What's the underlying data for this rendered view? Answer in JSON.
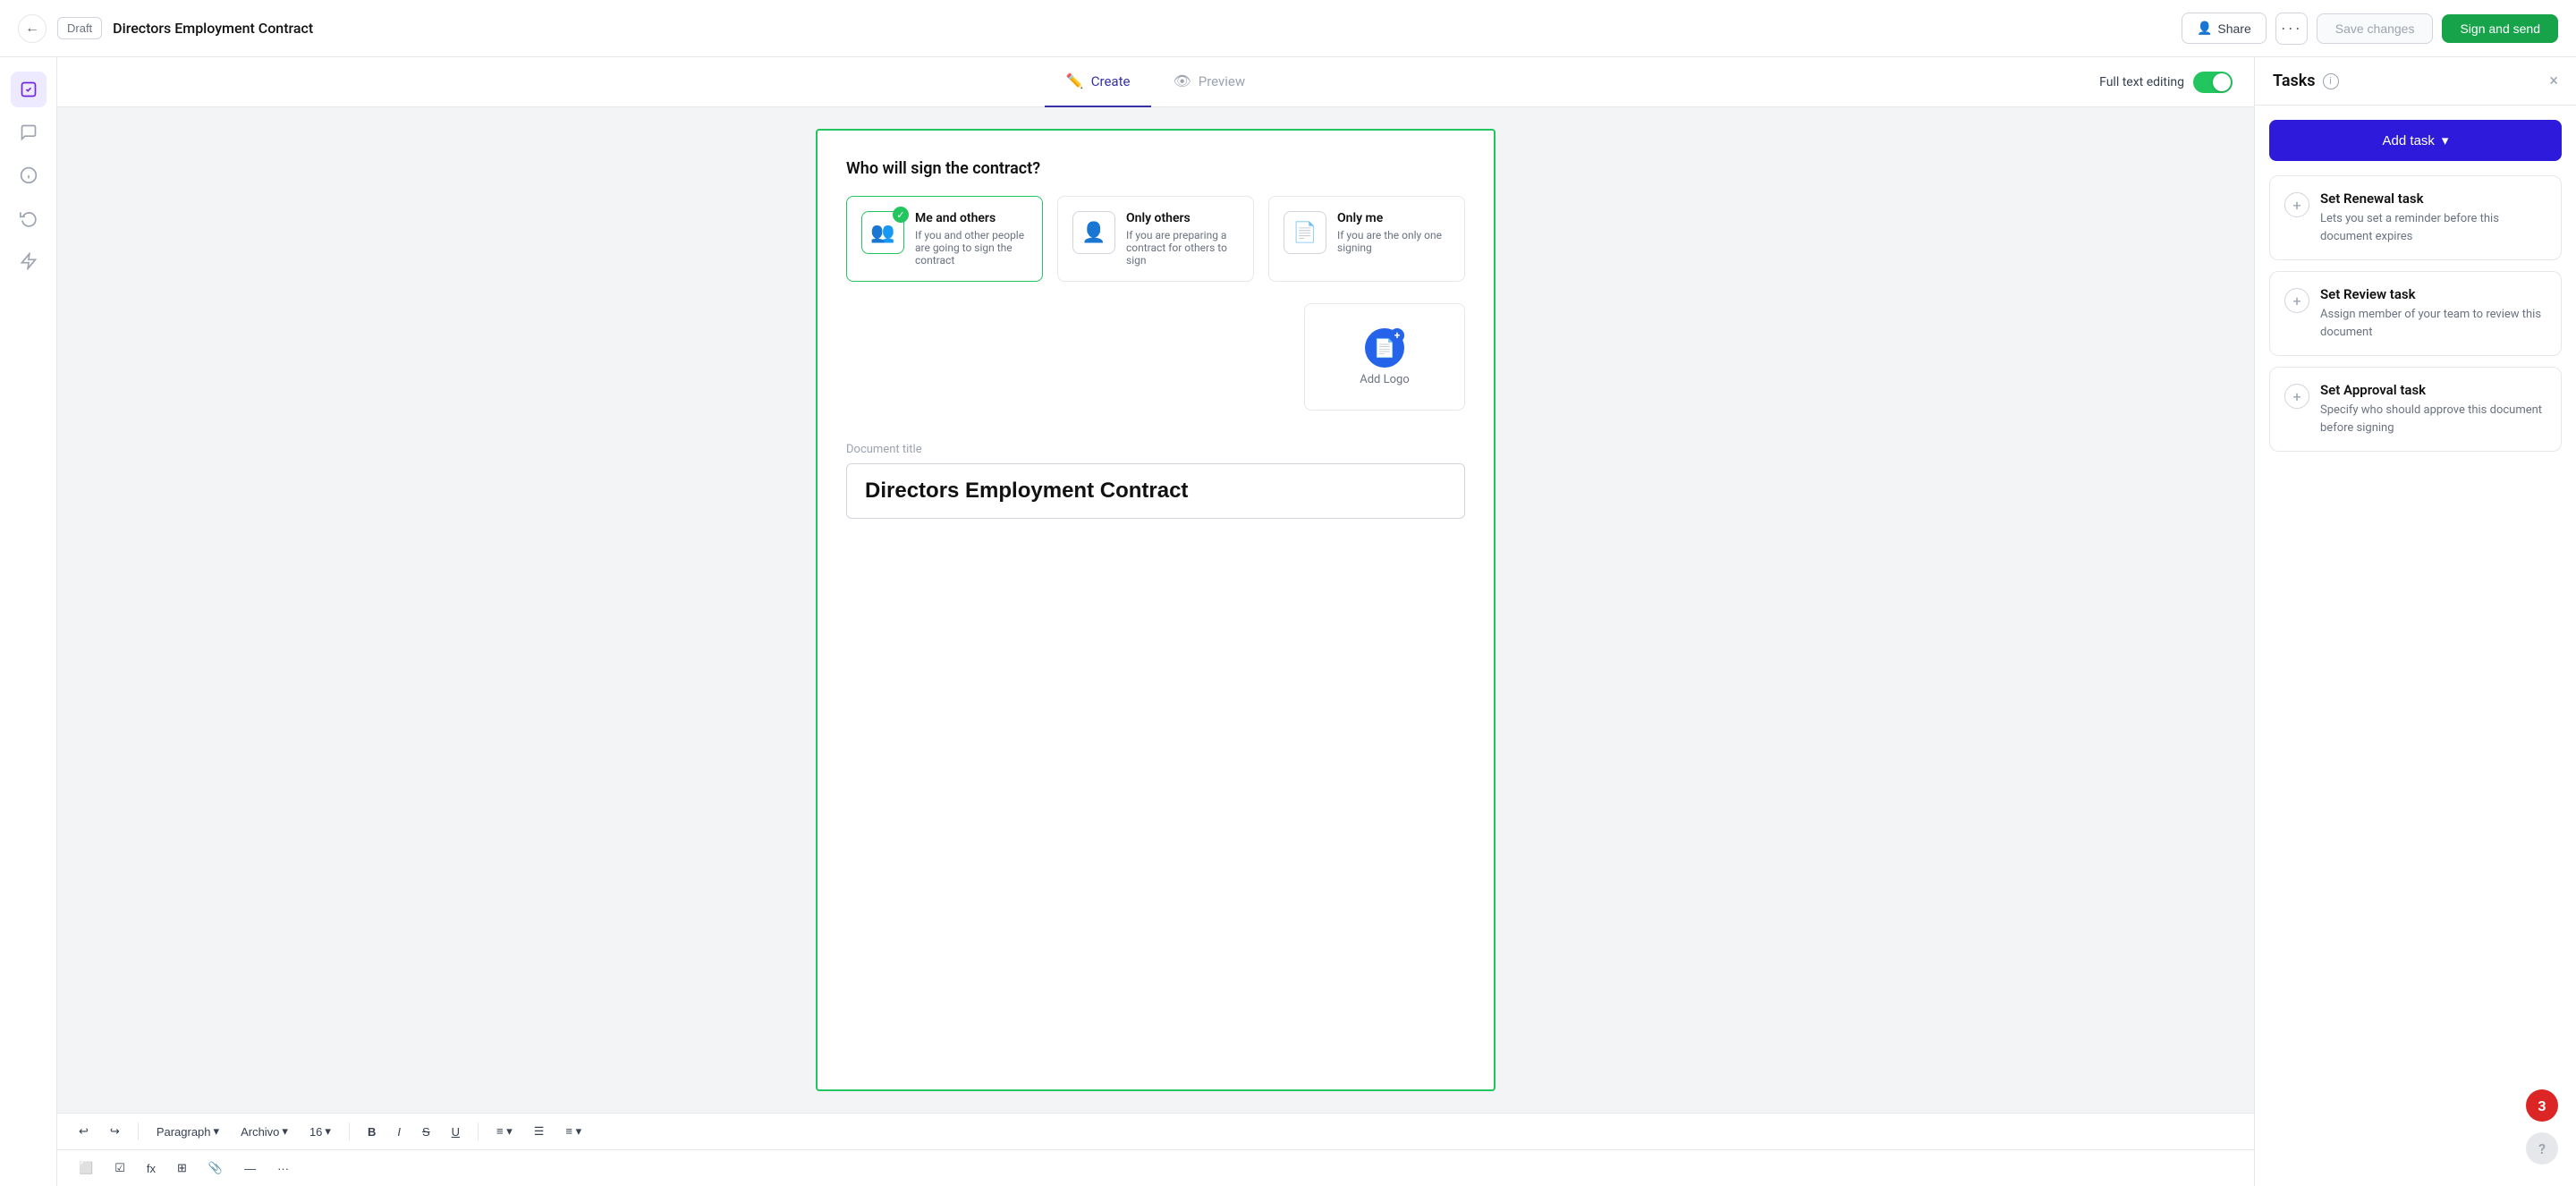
{
  "topbar": {
    "draft_label": "Draft",
    "doc_title": "Directors Employment Contract",
    "share_label": "Share",
    "more_label": "···",
    "save_label": "Save changes",
    "sign_label": "Sign and send"
  },
  "tabs": {
    "create_label": "Create",
    "preview_label": "Preview",
    "full_text_label": "Full text editing"
  },
  "sign_options": [
    {
      "title": "Me and others",
      "desc": "If you and other people are going to sign the contract",
      "icon": "👥",
      "selected": true
    },
    {
      "title": "Only others",
      "desc": "If you are preparing a contract for others to sign",
      "icon": "👤",
      "selected": false
    },
    {
      "title": "Only me",
      "desc": "If you are the only one signing",
      "icon": "📄",
      "selected": false
    }
  ],
  "who_sign_heading": "Who will sign the contract?",
  "logo_area": {
    "logo_label": "Logo",
    "add_logo_label": "Add Logo"
  },
  "document": {
    "title_label": "Document title",
    "title_value": "Directors Employment Contract"
  },
  "toolbar": {
    "undo": "↩",
    "redo": "↪",
    "paragraph": "Paragraph",
    "font": "Archivo",
    "size": "16",
    "bold": "B",
    "italic": "I",
    "strike": "S",
    "underline": "U",
    "align": "≡",
    "list": "≡",
    "line_spacing": "≡"
  },
  "right_panel": {
    "title": "Tasks",
    "add_task_label": "Add task",
    "close": "×",
    "tasks": [
      {
        "title": "Set Renewal task",
        "desc": "Lets you set a reminder before this document expires"
      },
      {
        "title": "Set Review task",
        "desc": "Assign member of your team to review this document"
      },
      {
        "title": "Set Approval task",
        "desc": "Specify who should approve this document before signing"
      }
    ]
  },
  "notification_count": "3",
  "help_label": "?"
}
